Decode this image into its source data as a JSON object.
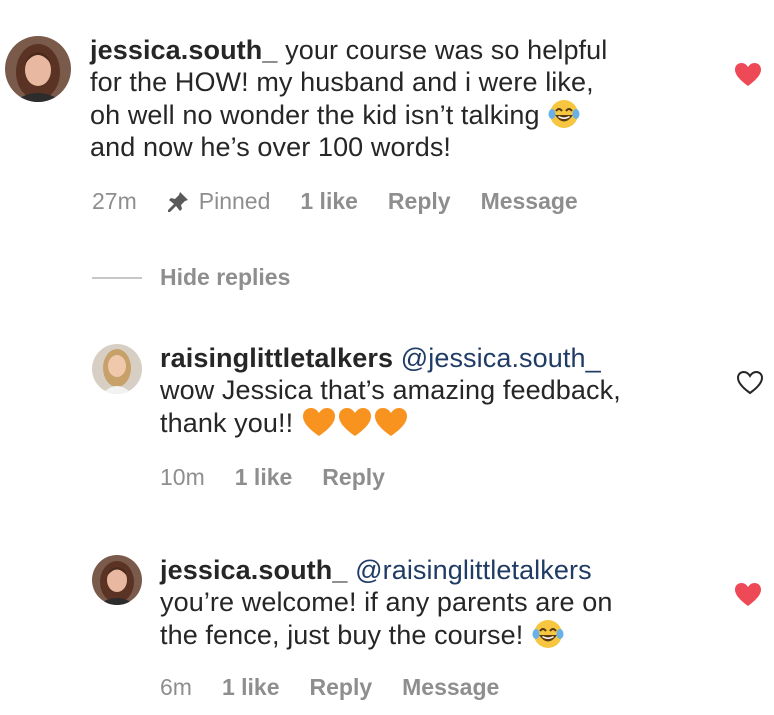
{
  "comments": [
    {
      "username": "jessica.south_",
      "text_lines": [
        "your course was so helpful",
        "for the HOW! my husband and i were like,",
        "oh well no wonder the kid isn’t talking"
      ],
      "text_last": "and now he’s over 100 words!",
      "emoji": "laughing-tears-emoji",
      "time": "27m",
      "pinned_label": "Pinned",
      "likes": "1 like",
      "reply": "Reply",
      "message": "Message",
      "liked": true
    },
    {
      "username": "raisinglittletalkers",
      "mention": "@jessica.south_",
      "text_line1": "wow Jessica that’s amazing feedback,",
      "text_line2": "thank you!!",
      "emoji": "orange-heart-emoji",
      "time": "10m",
      "likes": "1 like",
      "reply": "Reply",
      "liked": false
    },
    {
      "username": "jessica.south_",
      "mention": "@raisinglittletalkers",
      "text_line1": "you’re welcome! if any parents are on",
      "text_line2": "the fence, just buy the course!",
      "emoji": "laughing-tears-emoji",
      "time": "6m",
      "likes": "1 like",
      "reply": "Reply",
      "message": "Message",
      "liked": true
    }
  ],
  "hide_replies": "Hide replies",
  "colors": {
    "heart_liked": "#ed4956",
    "meta_text": "#8e8e8e",
    "text": "#262626",
    "mention": "#1f3b66"
  }
}
